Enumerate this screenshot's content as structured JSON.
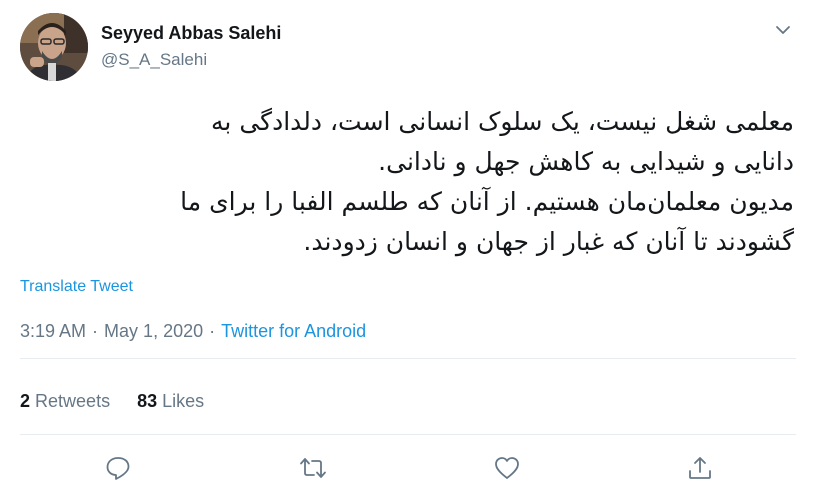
{
  "author": {
    "name": "Seyyed Abbas Salehi",
    "handle": "@S_A_Salehi"
  },
  "tweet": {
    "lines": [
      "معلمی شغل نیست، یک سلوک انسانی است، دلدادگی به",
      "دانایی و شیدایی به کاهش جهل و نادانی.",
      "مدیون معلمان‌مان هستیم. از آنان که طلسم الفبا را برای ما",
      "گشودند تا آنان که غبار از جهان و انسان زدودند."
    ],
    "translate_label": "Translate Tweet"
  },
  "meta": {
    "time": "3:19 AM",
    "separator": "·",
    "date": "May 1, 2020",
    "source": "Twitter for Android"
  },
  "stats": {
    "retweets_count": "2",
    "retweets_label": "Retweets",
    "likes_count": "83",
    "likes_label": "Likes"
  },
  "icons": {
    "caret": "chevron-down-icon",
    "reply": "reply-icon",
    "retweet": "retweet-icon",
    "like": "heart-icon",
    "share": "share-icon"
  },
  "colors": {
    "link": "#1b95e0",
    "secondary_text": "#657786",
    "primary_text": "#14171a",
    "divider": "#e6ecf0"
  }
}
